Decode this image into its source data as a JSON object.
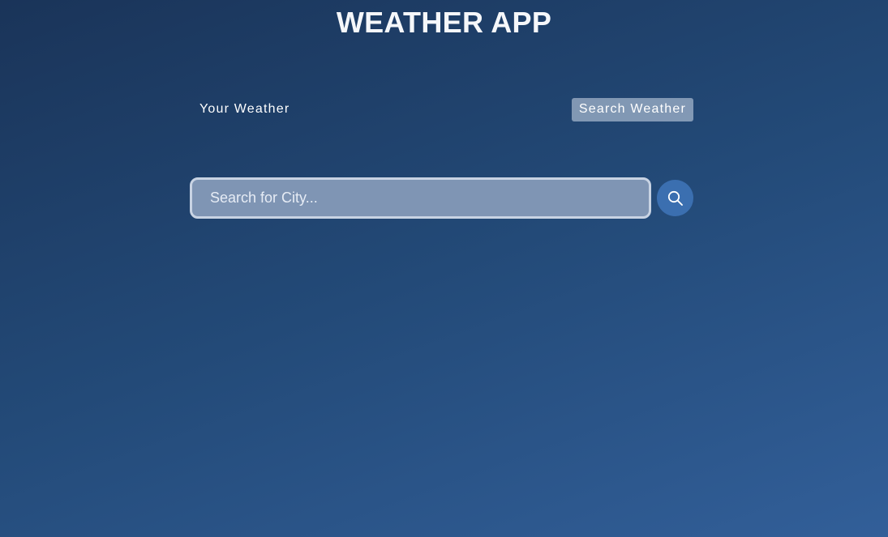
{
  "app": {
    "title": "WEATHER APP"
  },
  "tabs": {
    "your_weather": "Your Weather",
    "search_weather": "Search Weather",
    "active": "search_weather"
  },
  "search": {
    "placeholder": "Search for City...",
    "value": "",
    "button_icon": "search-icon"
  },
  "colors": {
    "background_top": "#1a3459",
    "background_bottom": "#325f99",
    "active_tab_bg": "#8a9cb8",
    "input_bg": "#7f95b4",
    "input_border": "#c8d3e3",
    "search_button_bg": "#3b6fb0"
  }
}
